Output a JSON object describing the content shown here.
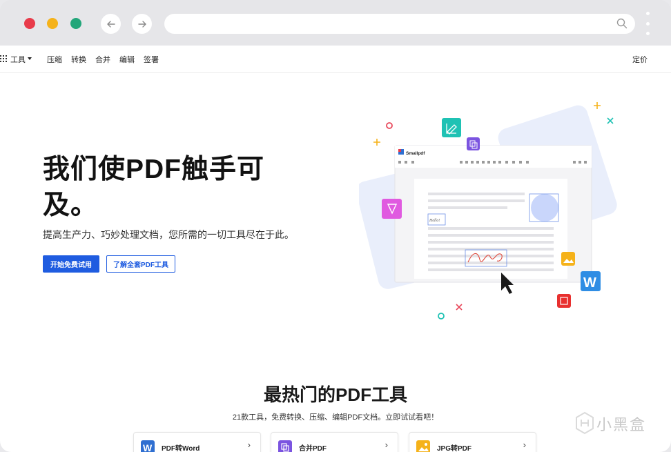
{
  "browser": {
    "back_icon": "arrow-left-icon",
    "forward_icon": "arrow-right-icon",
    "search_icon": "search-icon",
    "menu_icon": "kebab-menu-icon",
    "traffic_light_colors": [
      "#e83b4a",
      "#f5b21a",
      "#23a67a"
    ]
  },
  "nav": {
    "tools_label": "工具",
    "items": [
      "压缩",
      "转换",
      "合并",
      "编辑",
      "签署"
    ],
    "pricing_label": "定价"
  },
  "hero": {
    "title": "我们使PDF触手可及。",
    "subtitle": "提高生产力、巧妙处理文档，您所需的一切工具尽在于此。",
    "primary_cta": "开始免费试用",
    "secondary_cta": "了解全套PDF工具"
  },
  "illustration": {
    "app_name": "Smallpdf",
    "sample_text": "Hello!"
  },
  "popular": {
    "title": "最热门的PDF工具",
    "subtitle": "21款工具，免费转换、压缩、编辑PDF文档。立即试试看吧！",
    "cards": [
      {
        "label": "PDF转Word",
        "icon": "word-icon",
        "color": "#2f6fd1"
      },
      {
        "label": "合并PDF",
        "icon": "merge-icon",
        "color": "#7b54e0"
      },
      {
        "label": "JPG转PDF",
        "icon": "image-icon",
        "color": "#f5b21a"
      }
    ]
  },
  "watermark": {
    "text": "小黑盒"
  },
  "colors": {
    "accent": "#1f5ce0",
    "frame": "#e6e6e9"
  }
}
